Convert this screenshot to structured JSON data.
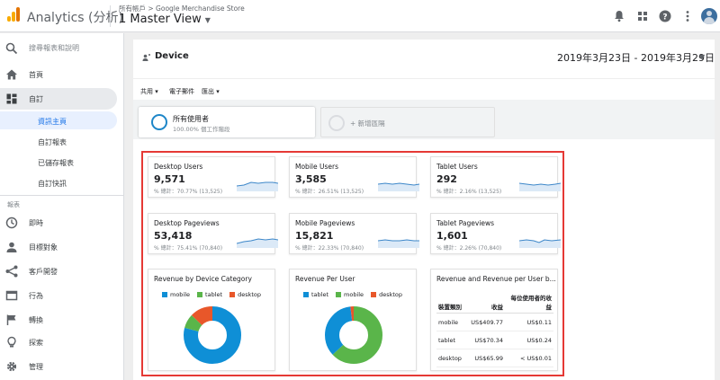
{
  "header": {
    "app_title": "Analytics (分析)",
    "breadcrumb": "所有帳戶 > Google Merchandise Store",
    "view": "1 Master View"
  },
  "sidebar": {
    "search_placeholder": "搜尋報表和說明",
    "top_items": [
      {
        "label": "首頁",
        "icon": "home-icon"
      },
      {
        "label": "自訂",
        "icon": "dashboard-icon"
      }
    ],
    "sub_items": [
      {
        "label": "資訊主頁"
      },
      {
        "label": "自訂報表"
      },
      {
        "label": "已儲存報表"
      },
      {
        "label": "自訂快訊"
      }
    ],
    "section_label": "報表",
    "report_items": [
      {
        "label": "即時",
        "icon": "clock-icon"
      },
      {
        "label": "目標對象",
        "icon": "person-icon"
      },
      {
        "label": "客戶開發",
        "icon": "acquisition-icon"
      },
      {
        "label": "行為",
        "icon": "behavior-icon"
      },
      {
        "label": "轉換",
        "icon": "flag-icon"
      }
    ],
    "bottom_items": [
      {
        "label": "探索",
        "icon": "lightbulb-icon"
      },
      {
        "label": "管理",
        "icon": "gear-icon"
      }
    ]
  },
  "main": {
    "title": "Device",
    "date_range": "2019年3月23日 - 2019年3月29日",
    "toolbar": {
      "share": "共用",
      "email": "電子郵件",
      "export": "匯出"
    },
    "segments": {
      "active_name": "所有使用者",
      "active_sub": "100.00% 個工作階段",
      "add_label": "+ 新增區隔"
    }
  },
  "kpis": [
    {
      "title": "Desktop Users",
      "value": "9,571",
      "pct": "% 總計：70.77% (13,525)"
    },
    {
      "title": "Mobile Users",
      "value": "3,585",
      "pct": "% 總計：26.51% (13,525)"
    },
    {
      "title": "Tablet Users",
      "value": "292",
      "pct": "% 總計：2.16% (13,525)"
    },
    {
      "title": "Desktop Pageviews",
      "value": "53,418",
      "pct": "% 總計：75.41% (70,840)"
    },
    {
      "title": "Mobile Pageviews",
      "value": "15,821",
      "pct": "% 總計：22.33% (70,840)"
    },
    {
      "title": "Tablet Pageviews",
      "value": "1,601",
      "pct": "% 總計：2.26% (70,840)"
    }
  ],
  "colors": {
    "mobile": "#0f8fd6",
    "tablet": "#5ab54a",
    "desktop": "#e8572a",
    "accent": "#1d86c8",
    "highlight": "#e53935"
  },
  "chart_data": [
    {
      "type": "pie",
      "title": "Revenue by Device Category",
      "categories": [
        "mobile",
        "tablet",
        "desktop"
      ],
      "values": [
        79,
        8,
        13
      ],
      "slice_labels": [
        "",
        "",
        ""
      ]
    },
    {
      "type": "pie",
      "title": "Revenue Per User",
      "categories": [
        "tablet",
        "mobile",
        "desktop"
      ],
      "values": [
        63,
        35,
        2
      ],
      "slice_labels": [
        "",
        "",
        ""
      ]
    }
  ],
  "rev_table": {
    "title": "Revenue and Revenue per User b...",
    "headers": [
      "裝置類別",
      "收益",
      "每位使用者的收益"
    ],
    "rows": [
      [
        "mobile",
        "US$409.77",
        "US$0.11"
      ],
      [
        "tablet",
        "US$70.34",
        "US$0.24"
      ],
      [
        "desktop",
        "US$65.99",
        "< US$0.01"
      ]
    ]
  }
}
